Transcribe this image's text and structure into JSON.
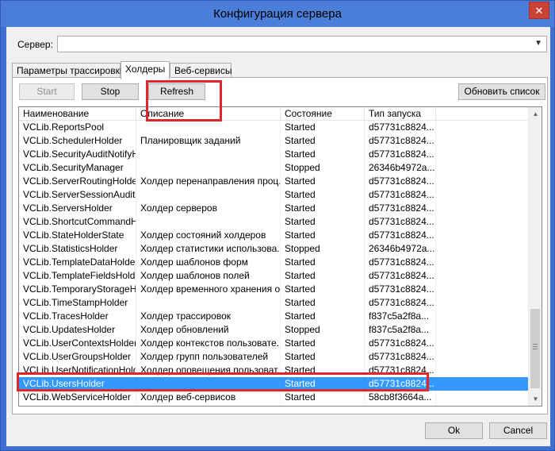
{
  "window": {
    "title": "Конфигурация сервера",
    "close_glyph": "✕"
  },
  "server": {
    "label": "Сервер:",
    "value": ""
  },
  "tabs": [
    {
      "label": "Параметры трассировки",
      "active": false
    },
    {
      "label": "Холдеры",
      "active": true
    },
    {
      "label": "Веб-сервисы",
      "active": false
    }
  ],
  "toolbar": {
    "start_label": "Start",
    "stop_label": "Stop",
    "refresh_label": "Refresh",
    "update_list_label": "Обновить список"
  },
  "table": {
    "columns": [
      "Наименование",
      "Описание",
      "Состояние",
      "Тип запуска"
    ],
    "rows": [
      [
        "VCLib.ReportsPool",
        "",
        "Started",
        "d57731c8824..."
      ],
      [
        "VCLib.SchedulerHolder",
        "Планировщик заданий",
        "Started",
        "d57731c8824..."
      ],
      [
        "VCLib.SecurityAuditNotifyH...",
        "",
        "Started",
        "d57731c8824..."
      ],
      [
        "VCLib.SecurityManager",
        "",
        "Stopped",
        "26346b4972a..."
      ],
      [
        "VCLib.ServerRoutingHolder",
        "Холдер перенаправления проц...",
        "Started",
        "d57731c8824..."
      ],
      [
        "VCLib.ServerSessionAudit...",
        "",
        "Started",
        "d57731c8824..."
      ],
      [
        "VCLib.ServersHolder",
        "Холдер серверов",
        "Started",
        "d57731c8824..."
      ],
      [
        "VCLib.ShortcutCommandH...",
        "",
        "Started",
        "d57731c8824..."
      ],
      [
        "VCLib.StateHolderState",
        "Холдер состояний холдеров",
        "Started",
        "d57731c8824..."
      ],
      [
        "VCLib.StatisticsHolder",
        "Холдер статистики использова...",
        "Stopped",
        "26346b4972a..."
      ],
      [
        "VCLib.TemplateDataHolder",
        "Холдер шаблонов форм",
        "Started",
        "d57731c8824..."
      ],
      [
        "VCLib.TemplateFieldsHolder",
        "Холдер шаблонов полей",
        "Started",
        "d57731c8824..."
      ],
      [
        "VCLib.TemporaryStorageH...",
        "Холдер временного хранения о...",
        "Started",
        "d57731c8824..."
      ],
      [
        "VCLib.TimeStampHolder",
        "",
        "Started",
        "d57731c8824..."
      ],
      [
        "VCLib.TracesHolder",
        "Холдер трассировок",
        "Started",
        "f837c5a2f8a..."
      ],
      [
        "VCLib.UpdatesHolder",
        "Холдер обновлений",
        "Stopped",
        "f837c5a2f8a..."
      ],
      [
        "VCLib.UserContextsHolder",
        "Холдер контекстов пользовате...",
        "Started",
        "d57731c8824..."
      ],
      [
        "VCLib.UserGroupsHolder",
        "Холдер групп пользователей",
        "Started",
        "d57731c8824..."
      ],
      [
        "VCLib.UserNotificationHolder",
        "Холдер оповещения пользоват...",
        "Started",
        "d57731c8824..."
      ],
      [
        "VCLib.UsersHolder",
        "",
        "Started",
        "d57731c8824..."
      ],
      [
        "VCLib.WebServiceHolder",
        "Холдер веб-сервисов",
        "Started",
        "58cb8f3664a..."
      ]
    ],
    "selected_row": 19
  },
  "dialog": {
    "ok_label": "Ok",
    "cancel_label": "Cancel"
  },
  "colors": {
    "selection": "#3399ff",
    "annotation": "#e0262a",
    "title_bar": "#4a7ed8"
  }
}
